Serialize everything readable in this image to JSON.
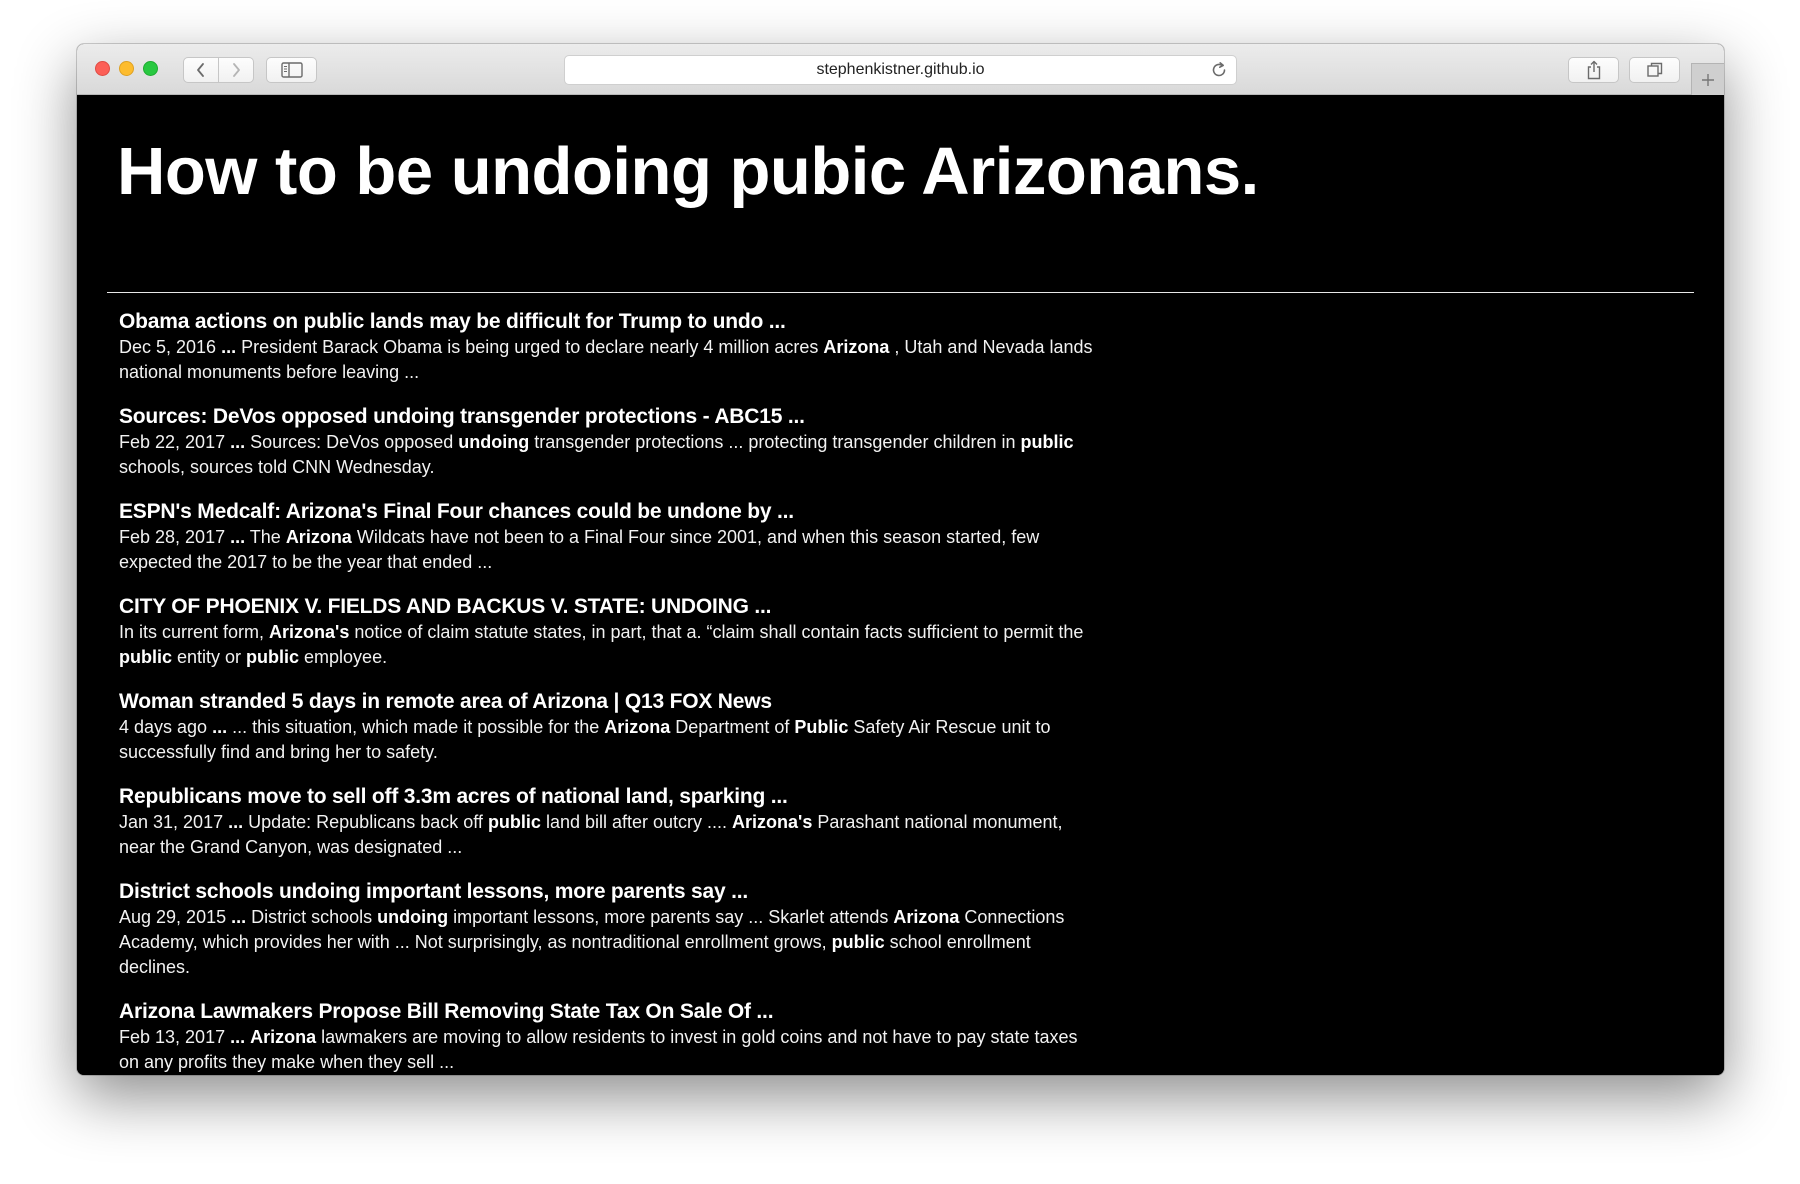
{
  "browser": {
    "url": "stephenkistner.github.io",
    "icons": {
      "back": "chevron-left-icon",
      "forward": "chevron-right-icon",
      "sidebar": "sidebar-icon",
      "reload": "reload-icon",
      "share": "share-icon",
      "tabs": "tabs-overview-icon",
      "new_tab": "plus-icon"
    }
  },
  "page": {
    "title": "How to be undoing pubic Arizonans.",
    "background": "#000000",
    "text_color": "#ffffff"
  },
  "results": [
    {
      "title": "Obama actions on public lands may be difficult for Trump to undo ...",
      "snippet": [
        {
          "t": "Dec 5, 2016 "
        },
        {
          "t": "...",
          "b": true
        },
        {
          "t": " President Barack Obama is being urged to declare nearly 4 million acres "
        },
        {
          "t": "Arizona",
          "b": true
        },
        {
          "t": " , Utah and Nevada lands national monuments before leaving ..."
        }
      ]
    },
    {
      "title": "Sources: DeVos opposed undoing transgender protections - ABC15 ...",
      "snippet": [
        {
          "t": "Feb 22, 2017 "
        },
        {
          "t": "...",
          "b": true
        },
        {
          "t": " Sources: DeVos opposed "
        },
        {
          "t": "undoing",
          "b": true
        },
        {
          "t": " transgender protections ... protecting transgender children in "
        },
        {
          "t": "public",
          "b": true
        },
        {
          "t": " schools, sources told CNN Wednesday."
        }
      ]
    },
    {
      "title": "ESPN's Medcalf: Arizona's Final Four chances could be undone by ...",
      "snippet": [
        {
          "t": "Feb 28, 2017 "
        },
        {
          "t": "...",
          "b": true
        },
        {
          "t": " The "
        },
        {
          "t": "Arizona",
          "b": true
        },
        {
          "t": " Wildcats have not been to a Final Four since 2001, and when this season started, few expected the 2017 to be the year that ended ..."
        }
      ]
    },
    {
      "title": "CITY OF PHOENIX V. FIELDS AND BACKUS V. STATE: UNDOING ...",
      "snippet": [
        {
          "t": "In its current form, "
        },
        {
          "t": "Arizona's",
          "b": true
        },
        {
          "t": " notice of claim statute states, in part, that a. “claim shall contain facts sufficient to permit the "
        },
        {
          "t": "public",
          "b": true
        },
        {
          "t": " entity or "
        },
        {
          "t": "public",
          "b": true
        },
        {
          "t": " employee."
        }
      ]
    },
    {
      "title": "Woman stranded 5 days in remote area of Arizona | Q13 FOX News",
      "snippet": [
        {
          "t": "4 days ago "
        },
        {
          "t": "...",
          "b": true
        },
        {
          "t": " ... this situation, which made it possible for the "
        },
        {
          "t": "Arizona",
          "b": true
        },
        {
          "t": " Department of "
        },
        {
          "t": "Public",
          "b": true
        },
        {
          "t": " Safety Air Rescue unit to successfully find and bring her to safety."
        }
      ]
    },
    {
      "title": "Republicans move to sell off 3.3m acres of national land, sparking ...",
      "snippet": [
        {
          "t": "Jan 31, 2017 "
        },
        {
          "t": "...",
          "b": true
        },
        {
          "t": " Update: Republicans back off "
        },
        {
          "t": "public",
          "b": true
        },
        {
          "t": " land bill after outcry .... "
        },
        {
          "t": "Arizona's",
          "b": true
        },
        {
          "t": " Parashant national monument, near the Grand Canyon, was designated ..."
        }
      ]
    },
    {
      "title": "District schools undoing important lessons, more parents say ...",
      "snippet": [
        {
          "t": "Aug 29, 2015 "
        },
        {
          "t": "...",
          "b": true
        },
        {
          "t": " District schools "
        },
        {
          "t": "undoing",
          "b": true
        },
        {
          "t": " important lessons, more parents say ... Skarlet attends "
        },
        {
          "t": "Arizona",
          "b": true
        },
        {
          "t": " Connections Academy, which provides her with ... Not surprisingly, as nontraditional enrollment grows, "
        },
        {
          "t": "public",
          "b": true
        },
        {
          "t": " school enrollment declines."
        }
      ]
    },
    {
      "title": "Arizona Lawmakers Propose Bill Removing State Tax On Sale Of ...",
      "snippet": [
        {
          "t": "Feb 13, 2017 "
        },
        {
          "t": "...",
          "b": true
        },
        {
          "t": " "
        },
        {
          "t": "Arizona",
          "b": true
        },
        {
          "t": " lawmakers are moving to allow residents to invest in gold coins and not have to pay state taxes on any profits they make when they sell ..."
        }
      ]
    }
  ]
}
